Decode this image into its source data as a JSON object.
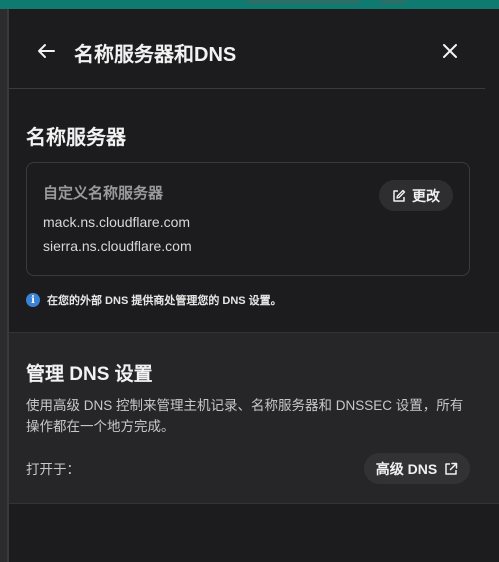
{
  "header": {
    "title": "名称服务器和DNS",
    "back_icon": "arrow-left-icon",
    "close_icon": "close-icon"
  },
  "nameservers": {
    "section_title": "名称服务器",
    "card_title": "自定义名称服务器",
    "edit_label": "更改",
    "items": [
      "mack.ns.cloudflare.com",
      "sierra.ns.cloudflare.com"
    ],
    "info_text": "在您的外部 DNS 提供商处管理您的 DNS 设置。"
  },
  "dns_settings": {
    "title": "管理 DNS 设置",
    "description": "使用高级 DNS 控制来管理主机记录、名称服务器和 DNSSEC 设置，所有操作都在一个地方完成。",
    "open_in_label": "打开于：",
    "advanced_dns_label": "高级 DNS"
  },
  "colors": {
    "accent_teal": "#0f7a70",
    "info_blue": "#3b82d6",
    "background": "#1c1c1e"
  }
}
